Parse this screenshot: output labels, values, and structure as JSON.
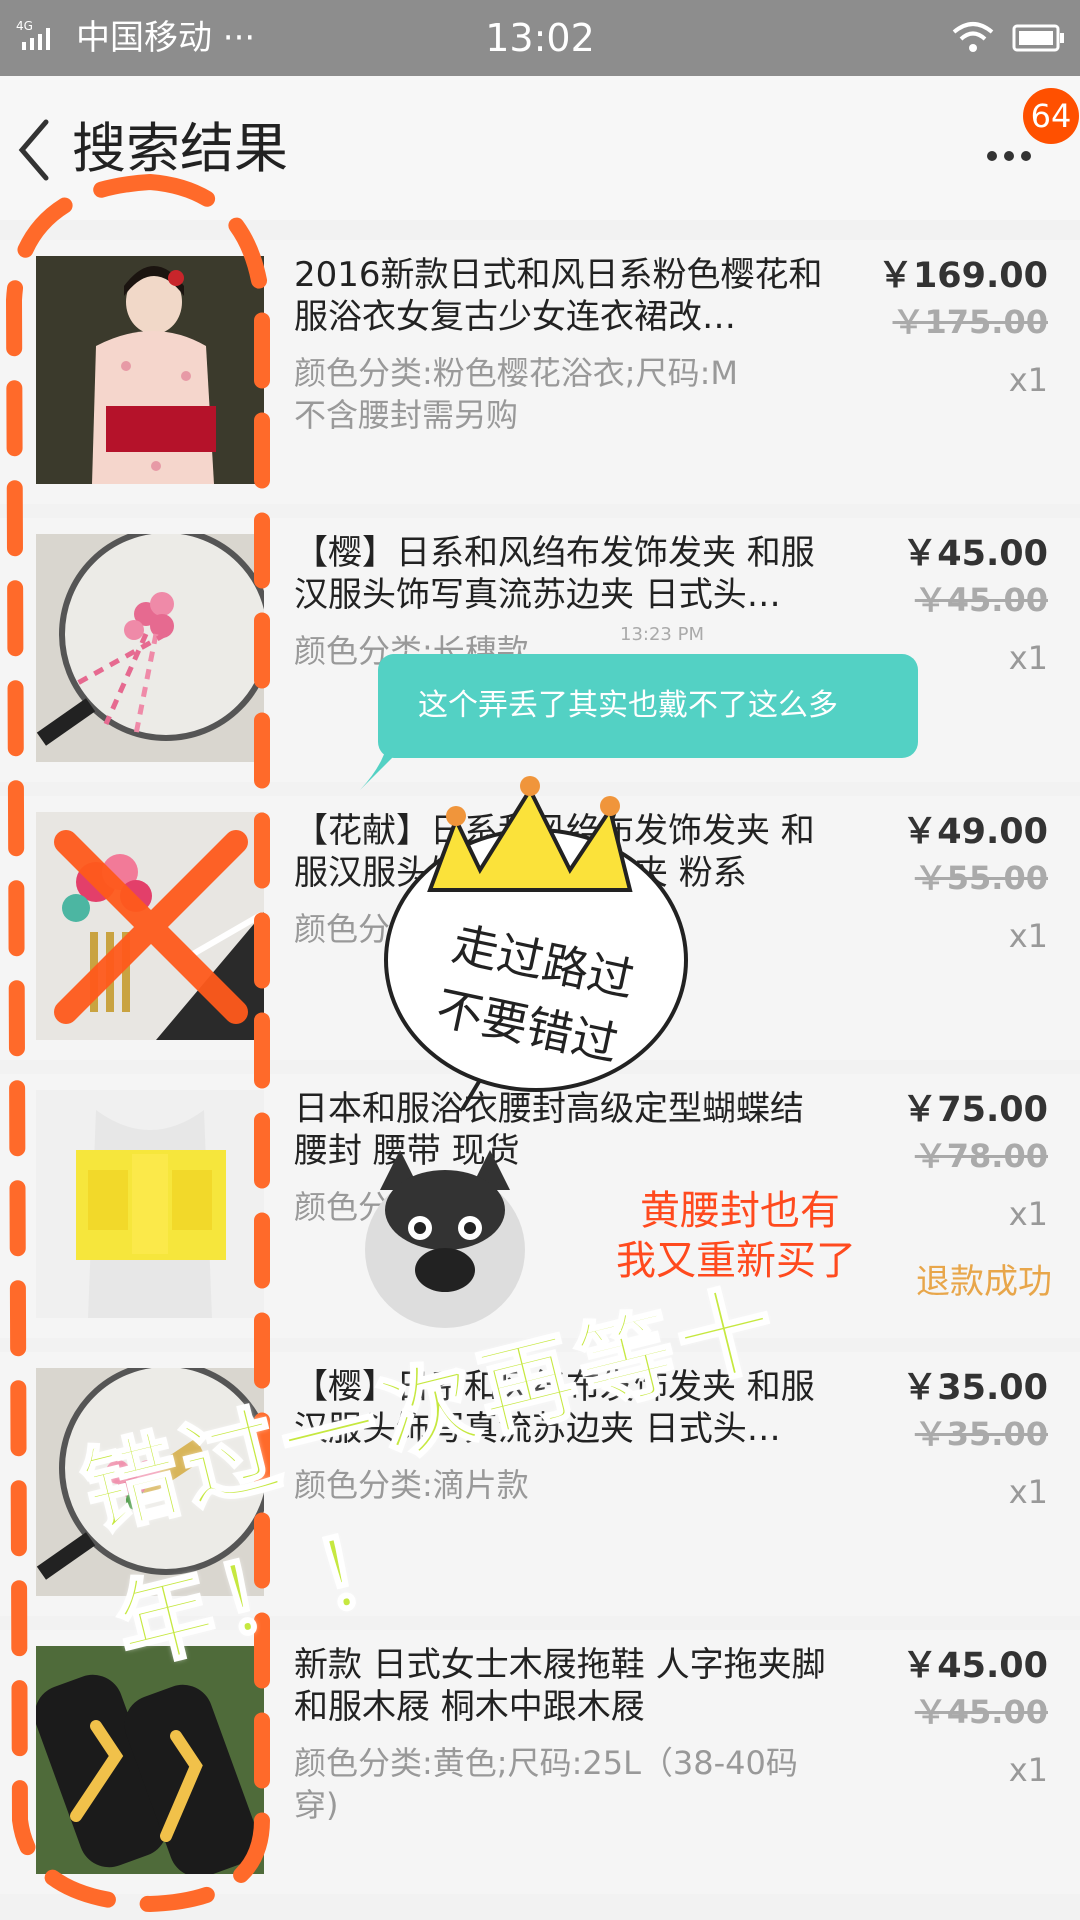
{
  "status_bar": {
    "network": "4G",
    "carrier": "中国移动 ···",
    "time": "13:02"
  },
  "header": {
    "title": "搜索结果",
    "badge_count": "64",
    "icons": {
      "back": "back-chevron-icon",
      "more": "more-dots-icon"
    }
  },
  "orders": [
    {
      "title": "2016新款日式和风日系粉色樱花和服浴衣女复古少女连衣裙改…",
      "specs": "颜色分类:粉色樱花浴衣;尺码:M",
      "specs2": "不含腰封需另购",
      "price": "￥169.00",
      "original_price": "￥175.00",
      "quantity": "x1"
    },
    {
      "title": "【樱】日系和风绉布发饰发夹 和服汉服头饰写真流苏边夹 日式头…",
      "specs": "颜色分类:长穗款",
      "specs2": "",
      "price": "￥45.00",
      "original_price": "￥45.00",
      "quantity": "x1"
    },
    {
      "title": "【花献】日系和风绉布发饰发夹 和服汉服头饰写真流苏边夹 粉系",
      "specs": "颜色分类",
      "specs2": "",
      "price": "￥49.00",
      "original_price": "￥55.00",
      "quantity": "x1"
    },
    {
      "title": "日本和服浴衣腰封高级定型蝴蝶结腰封 腰带 现货",
      "specs": "颜色分类:黄色",
      "specs2": "",
      "price": "￥75.00",
      "original_price": "￥78.00",
      "quantity": "x1",
      "status": "退款成功"
    },
    {
      "title": "【樱】日系和风绉布发饰发夹 和服汉服头饰写真流苏边夹 日式头…",
      "specs": "颜色分类:滴片款",
      "specs2": "",
      "price": "￥35.00",
      "original_price": "￥35.00",
      "quantity": "x1"
    },
    {
      "title": "新款 日式女士木屐拖鞋 人字拖夹脚和服木屐 桐木中跟木屐",
      "specs": "颜色分类:黄色;尺码:25L（38-40码",
      "specs2": "穿)",
      "price": "￥45.00",
      "original_price": "￥45.00",
      "quantity": "x1"
    }
  ],
  "overlays": {
    "chat_message": "这个弄丢了其实也戴不了这么多",
    "chat_time": "13:23 PM",
    "sticker_line1": "走过路过",
    "sticker_line2": "不要错过",
    "note_line1": "黄腰封也有",
    "note_line2": "我又重新买了",
    "banner": "错过一次再等十年！！"
  },
  "colors": {
    "accent_orange": "#ff5000",
    "refund_status": "#e8a64a",
    "chat_bubble": "#53d1c4",
    "banner_green": "#c6e840",
    "dashed_outline": "#ff6a2a"
  }
}
